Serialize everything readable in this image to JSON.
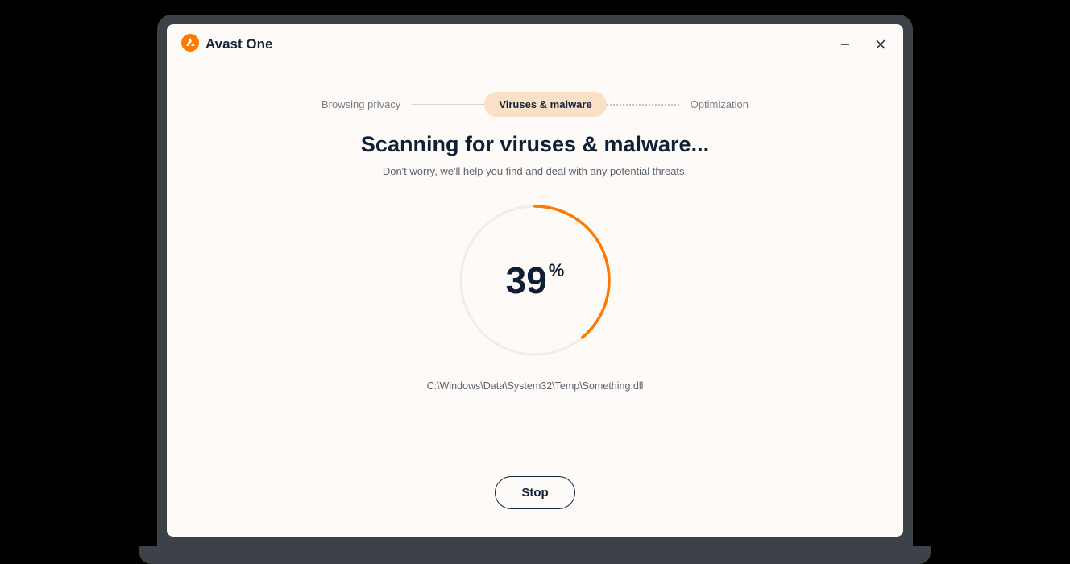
{
  "brand": {
    "name": "Avast One"
  },
  "window_controls": {
    "minimize": "–",
    "close": "✕"
  },
  "steps": {
    "items": [
      {
        "label": "Browsing privacy",
        "active": false
      },
      {
        "label": "Viruses & malware",
        "active": true
      },
      {
        "label": "Optimization",
        "active": false
      }
    ]
  },
  "scan": {
    "heading": "Scanning for viruses & malware...",
    "subheading": "Don't worry, we'll help you find and deal with any potential threats.",
    "progress_percent": 39,
    "percent_symbol": "%",
    "current_path": "C:\\Windows\\Data\\System32\\Temp\\Something.dll"
  },
  "actions": {
    "stop_label": "Stop"
  },
  "colors": {
    "accent": "#ff7800",
    "ring_track": "#f3ece3",
    "text_dark": "#102034"
  }
}
